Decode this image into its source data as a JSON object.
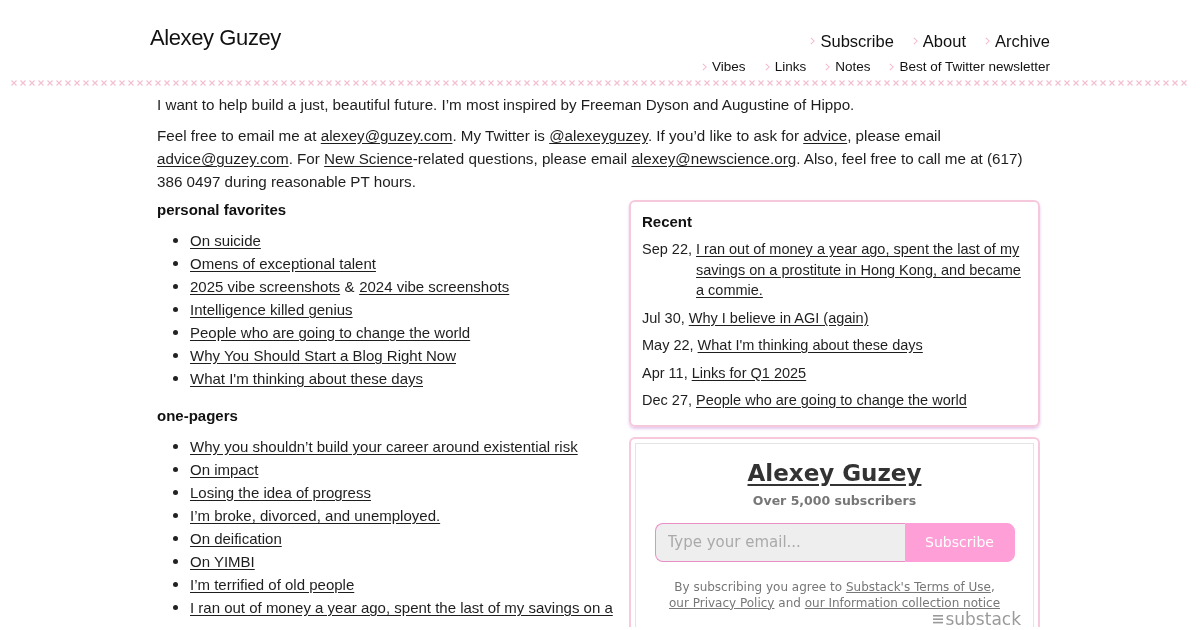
{
  "site": {
    "title": "Alexey Guzey"
  },
  "nav": {
    "primary": [
      {
        "label": "Subscribe"
      },
      {
        "label": "About"
      },
      {
        "label": "Archive"
      }
    ],
    "secondary": [
      {
        "label": "Vibes"
      },
      {
        "label": "Links"
      },
      {
        "label": "Notes"
      },
      {
        "label": "Best of Twitter newsletter"
      }
    ]
  },
  "intro": {
    "tagline": "I want to help build a just, beautiful future. I’m most inspired by Freeman Dyson and Augustine of Hippo.",
    "contact": [
      {
        "kind": "text",
        "text": "Feel free to email me at "
      },
      {
        "kind": "link",
        "text": "alexey@guzey.com"
      },
      {
        "kind": "text",
        "text": ". My Twitter is "
      },
      {
        "kind": "link",
        "text": "@alexeyguzey"
      },
      {
        "kind": "text",
        "text": ". If you’d like to ask for "
      },
      {
        "kind": "link",
        "text": "advice"
      },
      {
        "kind": "text",
        "text": ", please email "
      },
      {
        "kind": "link",
        "text": "advice@guzey.com"
      },
      {
        "kind": "text",
        "text": ". For "
      },
      {
        "kind": "link",
        "text": "New Science"
      },
      {
        "kind": "text",
        "text": "-related questions, please email "
      },
      {
        "kind": "link",
        "text": "alexey@newscience.org"
      },
      {
        "kind": "text",
        "text": ". Also, feel free to call me at (617) 386 0497 during reasonable PT hours."
      }
    ]
  },
  "sections": [
    {
      "heading": "personal favorites",
      "items": [
        {
          "parts": [
            {
              "kind": "link",
              "text": "On suicide"
            }
          ]
        },
        {
          "parts": [
            {
              "kind": "link",
              "text": "Omens of exceptional talent"
            }
          ]
        },
        {
          "parts": [
            {
              "kind": "link",
              "text": "2025 vibe screenshots"
            },
            {
              "kind": "text",
              "text": "&"
            },
            {
              "kind": "link",
              "text": "2024 vibe screenshots"
            }
          ]
        },
        {
          "parts": [
            {
              "kind": "link",
              "text": "Intelligence killed genius"
            }
          ]
        },
        {
          "parts": [
            {
              "kind": "link",
              "text": "People who are going to change the world"
            }
          ]
        },
        {
          "parts": [
            {
              "kind": "link",
              "text": "Why You Should Start a Blog Right Now"
            }
          ]
        },
        {
          "parts": [
            {
              "kind": "link",
              "text": "What I'm thinking about these days"
            }
          ]
        }
      ]
    },
    {
      "heading": "one-pagers",
      "items": [
        {
          "parts": [
            {
              "kind": "link",
              "text": "Why you shouldn’t build your career around existential risk"
            }
          ]
        },
        {
          "parts": [
            {
              "kind": "link",
              "text": "On impact"
            }
          ]
        },
        {
          "parts": [
            {
              "kind": "link",
              "text": "Losing the idea of progress"
            }
          ]
        },
        {
          "parts": [
            {
              "kind": "link",
              "text": "I’m broke, divorced, and unemployed."
            }
          ]
        },
        {
          "parts": [
            {
              "kind": "link",
              "text": "On deification"
            }
          ]
        },
        {
          "parts": [
            {
              "kind": "link",
              "text": "On YIMBI"
            }
          ]
        },
        {
          "parts": [
            {
              "kind": "link",
              "text": "I’m terrified of old people"
            }
          ]
        },
        {
          "parts": [
            {
              "kind": "link",
              "text": "I ran out of money a year ago, spent the last of my savings on a"
            }
          ]
        }
      ]
    }
  ],
  "recent": {
    "title": "Recent",
    "entries": [
      {
        "date": "Sep 22,",
        "title": "I ran out of money a year ago, spent the last of my savings on a prostitute in Hong Kong, and became a commie."
      },
      {
        "date": "Jul 30,",
        "title": "Why I believe in AGI (again)"
      },
      {
        "date": "May 22,",
        "title": "What I'm thinking about these days"
      },
      {
        "date": "Apr 11,",
        "title": "Links for Q1 2025"
      },
      {
        "date": "Dec 27,",
        "title": "People who are going to change the world"
      }
    ]
  },
  "newsletter": {
    "title": "Alexey Guzey",
    "subtitle": "Over 5,000 subscribers",
    "email": {
      "placeholder": "Type your email..."
    },
    "button": "Subscribe",
    "disclaimer": [
      {
        "kind": "text",
        "text": "By subscribing you agree to "
      },
      {
        "kind": "link",
        "text": "Substack's Terms of Use"
      },
      {
        "kind": "text",
        "text": ", "
      },
      {
        "kind": "link",
        "text": "our Privacy Policy"
      },
      {
        "kind": "text",
        "text": " and "
      },
      {
        "kind": "link",
        "text": "our Information collection notice"
      }
    ],
    "logo": "substack"
  }
}
